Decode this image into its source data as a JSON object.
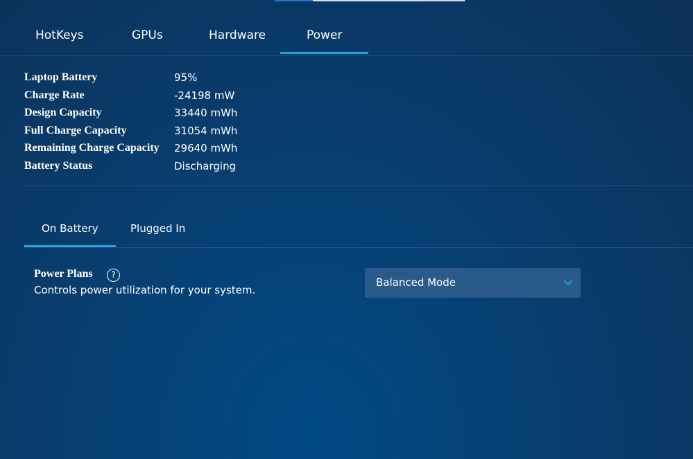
{
  "tabs": [
    {
      "label": "HotKeys"
    },
    {
      "label": "GPUs"
    },
    {
      "label": "Hardware"
    },
    {
      "label": "Power",
      "active": true
    }
  ],
  "battery_info": [
    {
      "label": "Laptop Battery",
      "value": "95%"
    },
    {
      "label": "Charge Rate",
      "value": "-24198 mW"
    },
    {
      "label": "Design Capacity",
      "value": "33440 mWh"
    },
    {
      "label": "Full Charge Capacity",
      "value": "31054 mWh"
    },
    {
      "label": "Remaining Charge Capacity",
      "value": "29640 mWh"
    },
    {
      "label": "Battery Status",
      "value": "Discharging"
    }
  ],
  "sub_tabs": [
    {
      "label": "On Battery",
      "active": true
    },
    {
      "label": "Plugged In"
    }
  ],
  "power_plans": {
    "title": "Power Plans",
    "help_icon": "?",
    "description": "Controls power utilization for your system.",
    "selected": "Balanced Mode"
  },
  "colors": {
    "accent": "#25a3e3",
    "background": "#0b3a6b",
    "dropdown_bg": "#2a5a8a"
  },
  "icons": {
    "help": "question-circle-icon",
    "dropdown": "chevron-down-icon"
  }
}
